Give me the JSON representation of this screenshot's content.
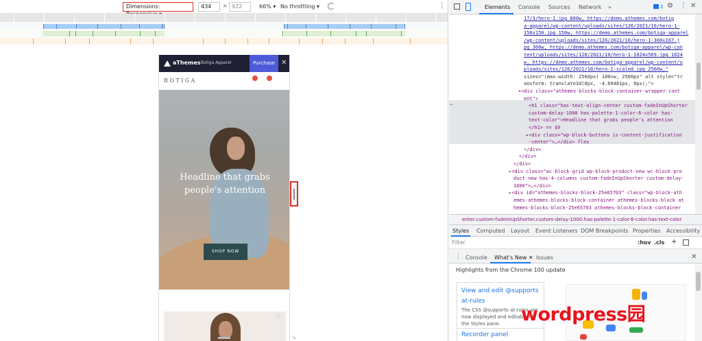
{
  "device_toolbar": {
    "dimensions_label": "Dimensions: Responsive ▾",
    "width": "434",
    "times": "×",
    "height_placeholder": "922",
    "zoom": "66% ▾",
    "throttling": "No throttling ▾",
    "more": "⋮"
  },
  "site": {
    "promo_brand": "aThemes",
    "promo_product": "Botiga Apparel",
    "purchase": "Purchase",
    "close": "✕",
    "logo": "BOTIGA",
    "hero_headline": "Headline that grabs people's attention",
    "shop_button": "SHOP NOW",
    "wishlist": "♡"
  },
  "devtools": {
    "tabs": [
      "Elements",
      "Console",
      "Sources",
      "Network",
      "»"
    ],
    "issues_count": "2",
    "gear": "⚙",
    "kebab": "⋮",
    "close": "✕",
    "dom_lines": [
      {
        "text": "17/3/hero-1.jpg 800w, https://demo.athemes.com/botig"
      },
      {
        "text": "a-apparel/wp-content/uploads/sites/126/2021/10/hero-1-"
      },
      {
        "text": "150x150.jpg 150w, https://demo.athemes.com/botiga-apparel"
      },
      {
        "text": "/wp-content/uploads/sites/126/2021/10/hero-1-300x167.j"
      },
      {
        "text": "pg 300w, https://demo.athemes.com/botiga-apparel/wp-con"
      },
      {
        "text": "tent/uploads/sites/126/2021/10/hero-1-1024x569.jpg 1024"
      },
      {
        "text": "w, https://demo.athemes.com/botiga-apparel/wp-content/u"
      },
      {
        "text": "ploads/sites/126/2021/10/hero-1-scaled.jpg 2560w,\""
      },
      {
        "text": "sizes=\"(max-width: 2560px) 100vw, 2560px\" alt style=\"tr"
      },
      {
        "text": "ansform: translate3d(0px, -4.69481px, 0px);\">"
      },
      {
        "text": "▾<div class=\"athemes-blocks-block-container-wrapper-cont"
      },
      {
        "text": "ent\">"
      },
      {
        "text": "<h1 class=\"has-text-align-center custom-fadeInUpShorter"
      },
      {
        "text": "custom-delay-1000 has-palette-1-color-6-color has-"
      },
      {
        "text": "text-color\">Headline that grabs people's attention"
      },
      {
        "text": "</h1> == $0"
      },
      {
        "text": "▸<div class=\"wp-block-buttons is-content-justification"
      },
      {
        "text": "-center\">…</div> flex"
      },
      {
        "text": "</div>"
      },
      {
        "text": "</div>"
      },
      {
        "text": "</div>"
      },
      {
        "text": "▸<div class=\"wc-block-grid wp-block-product-new wc-block-pro"
      },
      {
        "text": "duct-new has-4-columns custom-fadeInUpShorter custom-delay-"
      },
      {
        "text": "1600\">…</div>"
      },
      {
        "text": "▸<div id=\"athemes-blocks-block-25e65703\" class=\"wp-block-ath"
      },
      {
        "text": "emes-athemes-blocks-block-container athemes-blocks-block at"
      },
      {
        "text": "hemes-blocks-block-25e65703 athemes-blocks-block-container"
      }
    ],
    "dots": "…",
    "breadcrumb": "enter.custom-fadeInUpShorter.custom-delay-1000.has-palette-1-color-6-color.has-text-color",
    "styles_tabs": [
      "Styles",
      "Computed",
      "Layout",
      "Event Listeners",
      "DOM Breakpoints",
      "Properties",
      "Accessibility"
    ],
    "filter_placeholder": "Filter",
    "hov": ":hov",
    "cls": ".cls",
    "plus": "+",
    "drawer_kebab": "⋮",
    "drawer_tabs": [
      "Console",
      "What's New ✕",
      "Issues"
    ],
    "drawer_close": "✕",
    "highlights": "Highlights from the Chrome 100 update",
    "card_title": "View and edit @supports at-rules",
    "card_desc": "The CSS @supports at-rules are now displayed and editable in the Styles pane.",
    "card2_title": "Recorder panel"
  },
  "watermark": "wordpress园",
  "colors": {
    "accent": "#1a73e8",
    "highlight_red": "#d93025",
    "purchase": "#4e5bd9",
    "promo_bg": "#1f2033",
    "shop_button": "#2c4b4e",
    "watermark": "#e8141d"
  }
}
